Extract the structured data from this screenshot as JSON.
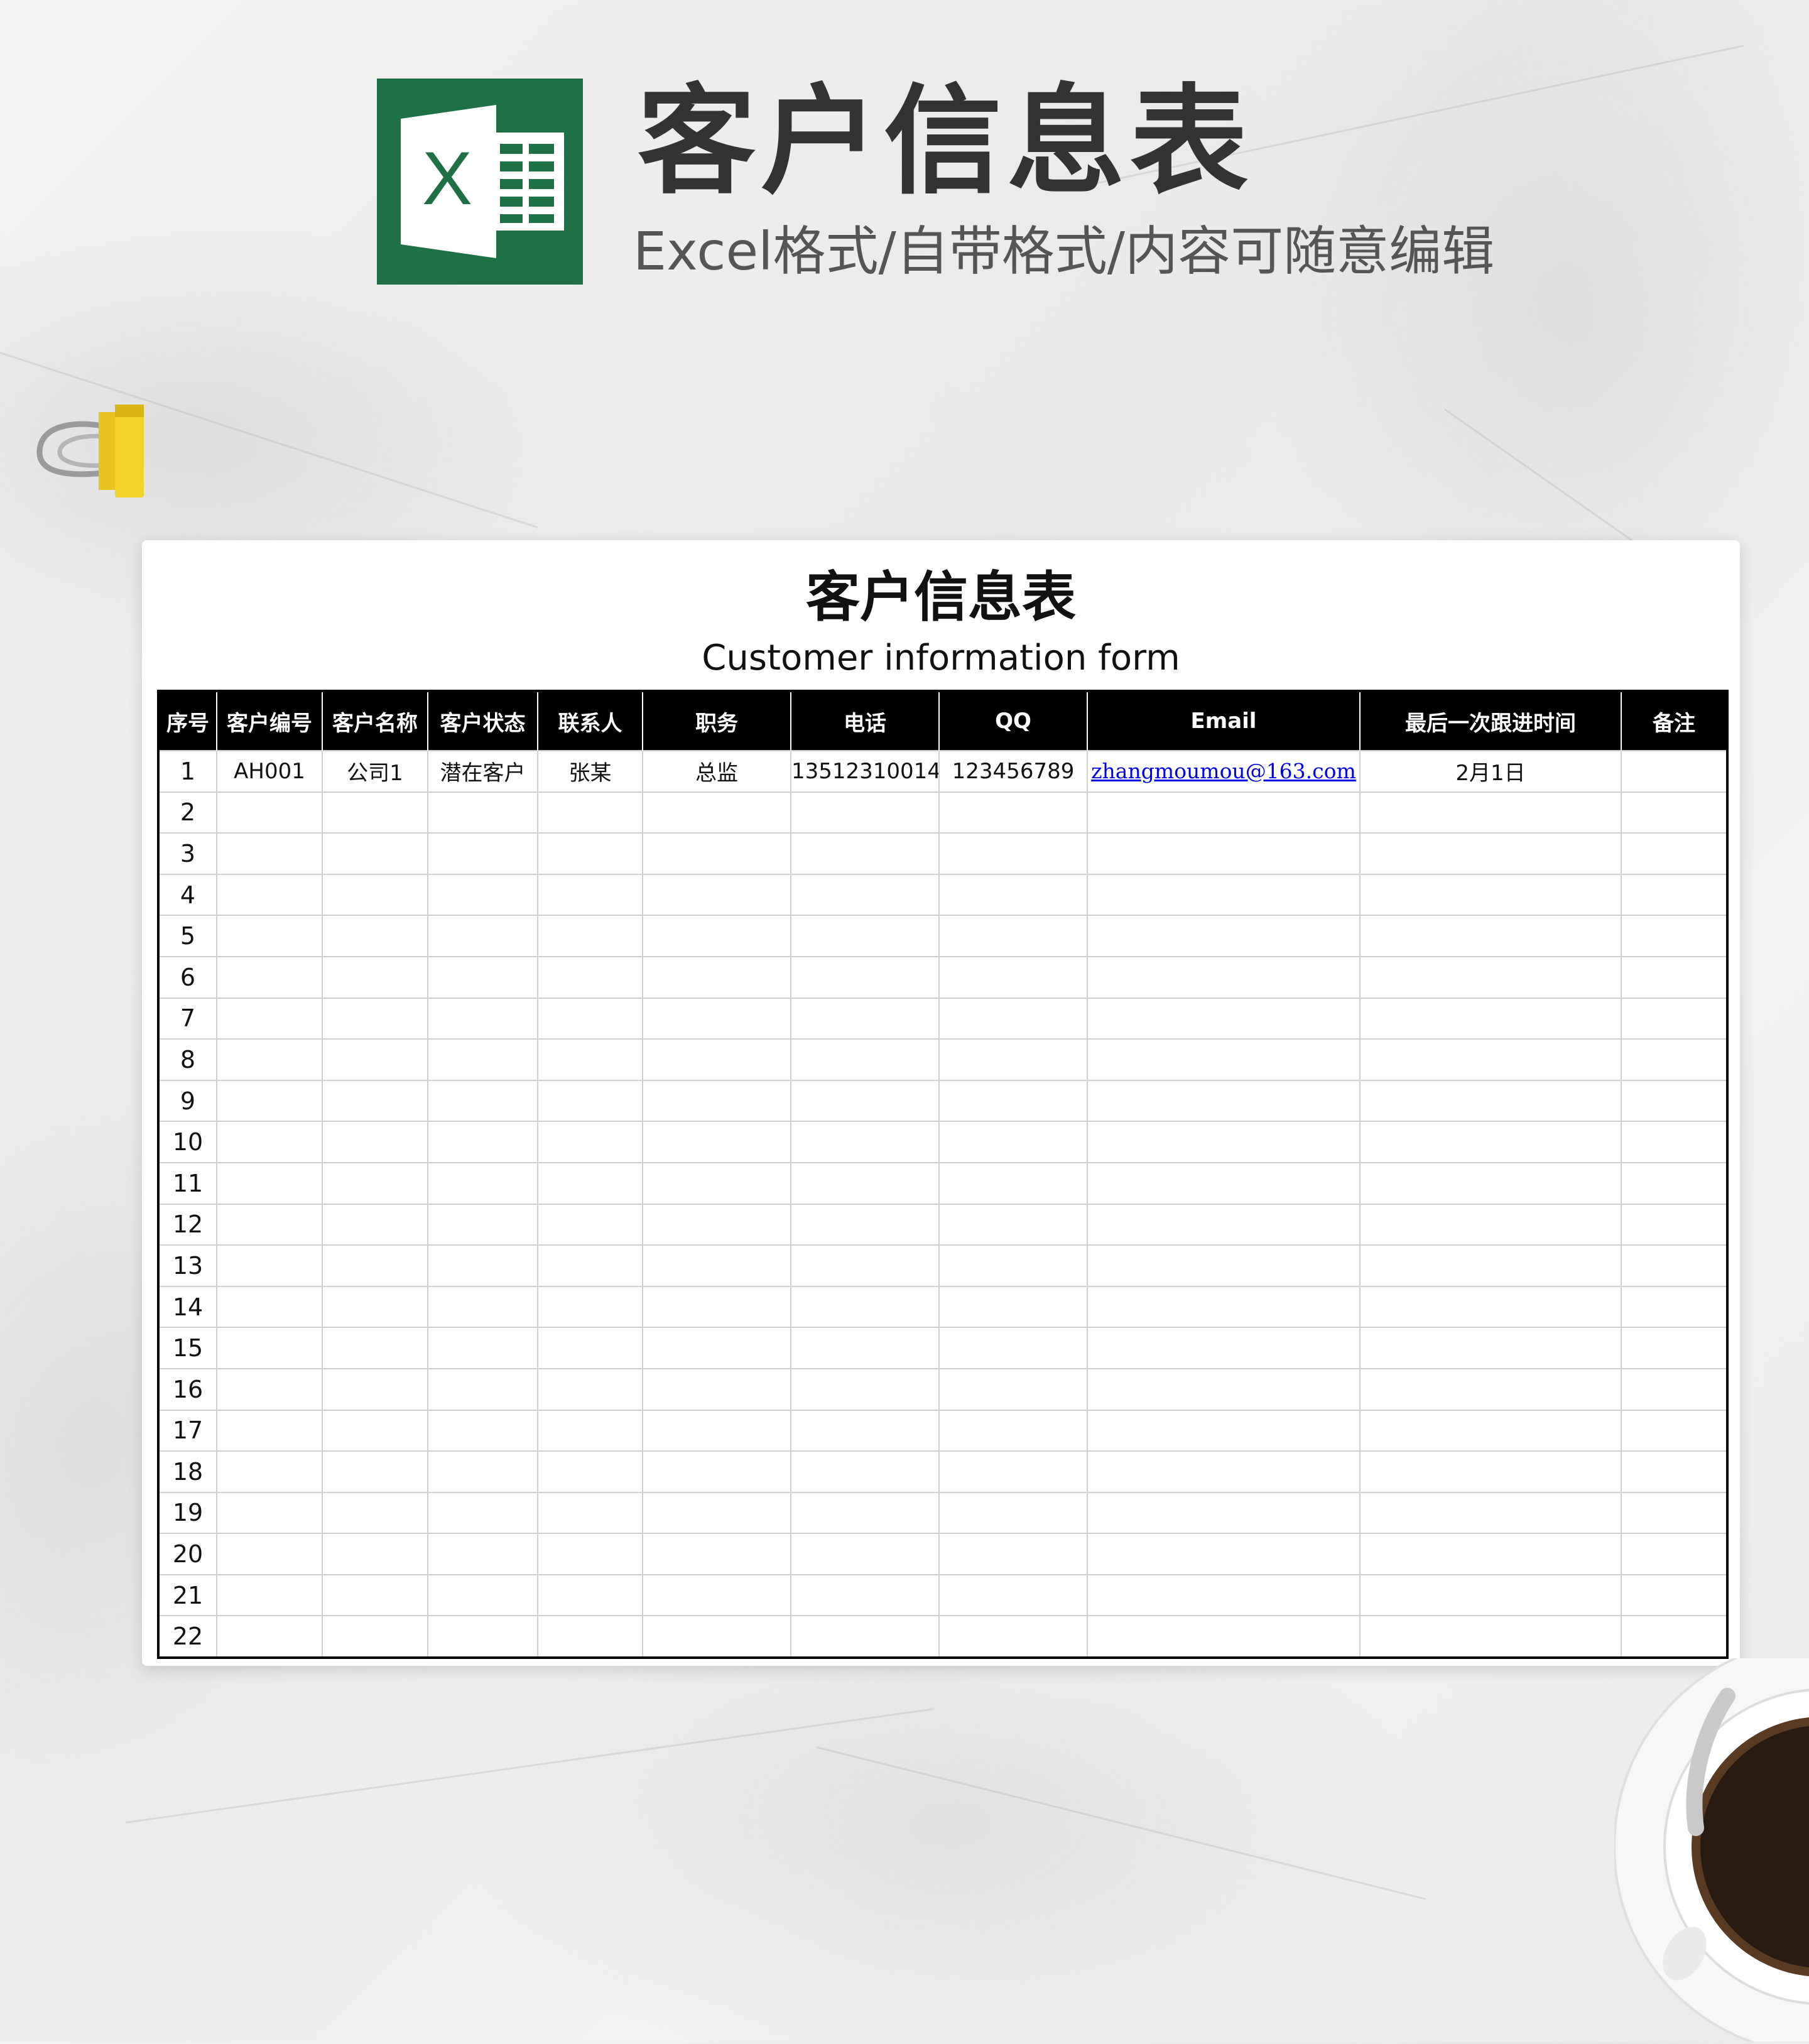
{
  "header": {
    "title": "客户信息表",
    "subtitle": "Excel格式/自带格式/内容可随意编辑",
    "logo_letter": "X"
  },
  "sheet": {
    "title": "客户信息表",
    "subtitle": "Customer information form",
    "columns": [
      "序号",
      "客户编号",
      "客户名称",
      "客户状态",
      "联系人",
      "职务",
      "电话",
      "QQ",
      "Email",
      "最后一次跟进时间",
      "备注"
    ],
    "rows": [
      [
        "1",
        "AH001",
        "公司1",
        "潜在客户",
        "张某",
        "总监",
        "13512310014",
        "123456789",
        "zhangmoumou@163.com",
        "2月1日",
        ""
      ],
      [
        "2",
        "",
        "",
        "",
        "",
        "",
        "",
        "",
        "",
        "",
        ""
      ],
      [
        "3",
        "",
        "",
        "",
        "",
        "",
        "",
        "",
        "",
        "",
        ""
      ],
      [
        "4",
        "",
        "",
        "",
        "",
        "",
        "",
        "",
        "",
        "",
        ""
      ],
      [
        "5",
        "",
        "",
        "",
        "",
        "",
        "",
        "",
        "",
        "",
        ""
      ],
      [
        "6",
        "",
        "",
        "",
        "",
        "",
        "",
        "",
        "",
        "",
        ""
      ],
      [
        "7",
        "",
        "",
        "",
        "",
        "",
        "",
        "",
        "",
        "",
        ""
      ],
      [
        "8",
        "",
        "",
        "",
        "",
        "",
        "",
        "",
        "",
        "",
        ""
      ],
      [
        "9",
        "",
        "",
        "",
        "",
        "",
        "",
        "",
        "",
        "",
        ""
      ],
      [
        "10",
        "",
        "",
        "",
        "",
        "",
        "",
        "",
        "",
        "",
        ""
      ],
      [
        "11",
        "",
        "",
        "",
        "",
        "",
        "",
        "",
        "",
        "",
        ""
      ],
      [
        "12",
        "",
        "",
        "",
        "",
        "",
        "",
        "",
        "",
        "",
        ""
      ],
      [
        "13",
        "",
        "",
        "",
        "",
        "",
        "",
        "",
        "",
        "",
        ""
      ],
      [
        "14",
        "",
        "",
        "",
        "",
        "",
        "",
        "",
        "",
        "",
        ""
      ],
      [
        "15",
        "",
        "",
        "",
        "",
        "",
        "",
        "",
        "",
        "",
        ""
      ],
      [
        "16",
        "",
        "",
        "",
        "",
        "",
        "",
        "",
        "",
        "",
        ""
      ],
      [
        "17",
        "",
        "",
        "",
        "",
        "",
        "",
        "",
        "",
        "",
        ""
      ],
      [
        "18",
        "",
        "",
        "",
        "",
        "",
        "",
        "",
        "",
        "",
        ""
      ],
      [
        "19",
        "",
        "",
        "",
        "",
        "",
        "",
        "",
        "",
        "",
        ""
      ],
      [
        "20",
        "",
        "",
        "",
        "",
        "",
        "",
        "",
        "",
        "",
        ""
      ],
      [
        "21",
        "",
        "",
        "",
        "",
        "",
        "",
        "",
        "",
        "",
        ""
      ],
      [
        "22",
        "",
        "",
        "",
        "",
        "",
        "",
        "",
        "",
        "",
        ""
      ]
    ]
  },
  "colors": {
    "excel_green": "#1e7145",
    "header_bg": "#000000",
    "link": "#0000ee",
    "clip_yellow": "#f2d12a"
  },
  "icons": {
    "logo": "excel-logo-icon",
    "clip": "binder-clip-icon",
    "coffee": "coffee-cup-icon"
  }
}
